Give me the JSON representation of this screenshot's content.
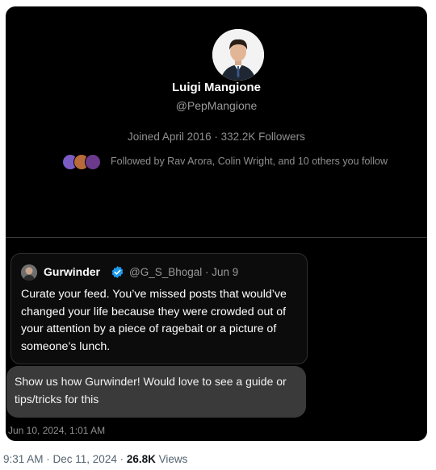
{
  "profile": {
    "name": "Luigi Mangione",
    "handle": "@PepMangione",
    "joined": "Joined April 2016 · 332.2K Followers",
    "followed_by": "Followed by Rav Arora, Colin Wright, and 10 others you follow"
  },
  "quote": {
    "name": "Gurwinder",
    "handle_date": "@G_S_Bhogal · Jun 9",
    "text": "Curate your feed. You’ve missed posts that would’ve changed your life because they were crowded out of your attention by a piece of ragebait or a picture of someone’s lunch."
  },
  "reply": {
    "text": "Show us how Gurwinder! Would love to see a guide or tips/tricks for this",
    "timestamp": "Jun 10, 2024, 1:01 AM"
  },
  "footer": {
    "time_date": "9:31 AM · Dec 11, 2024 · ",
    "views_count": "26.8K",
    "views_label": " Views"
  },
  "colors": {
    "verified_blue": "#1d9bf0",
    "card_bg": "#000000",
    "reply_bg": "#3a3a3a"
  }
}
